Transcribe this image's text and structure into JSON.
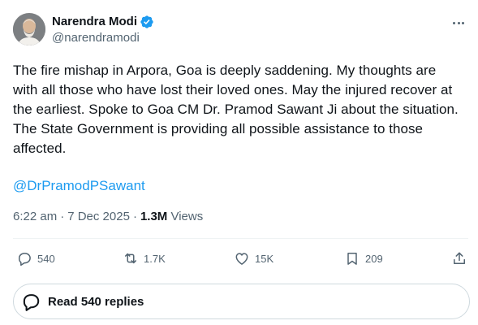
{
  "user": {
    "display_name": "Narendra Modi",
    "handle": "@narendramodi",
    "verified": true
  },
  "tweet": {
    "text": "The fire mishap in Arpora, Goa is deeply saddening. My thoughts are\nwith all those who have lost their loved ones. May the injured recover at\nthe earliest. Spoke to Goa CM Dr. Pramod Sawant Ji about the situation.\nThe State Government is providing all possible assistance to those\naffected.",
    "mention": "@DrPramodPSawant",
    "time": "6:22 am",
    "separator": "·",
    "date": "7 Dec 2025",
    "views_count": "1.3M",
    "views_label": "Views"
  },
  "actions": {
    "replies": "540",
    "reposts": "1.7K",
    "likes": "15K",
    "bookmarks": "209"
  },
  "replies_button": {
    "label": "Read 540 replies"
  },
  "colors": {
    "link": "#1d9bf0",
    "secondary_text": "#536471",
    "primary_text": "#0f1419",
    "verified_badge": "#1d9bf0"
  },
  "icons": {
    "more": "more-icon",
    "reply": "reply-icon",
    "repost": "repost-icon",
    "like": "heart-icon",
    "bookmark": "bookmark-icon",
    "share": "share-icon",
    "replies": "speech-bubble-icon"
  }
}
